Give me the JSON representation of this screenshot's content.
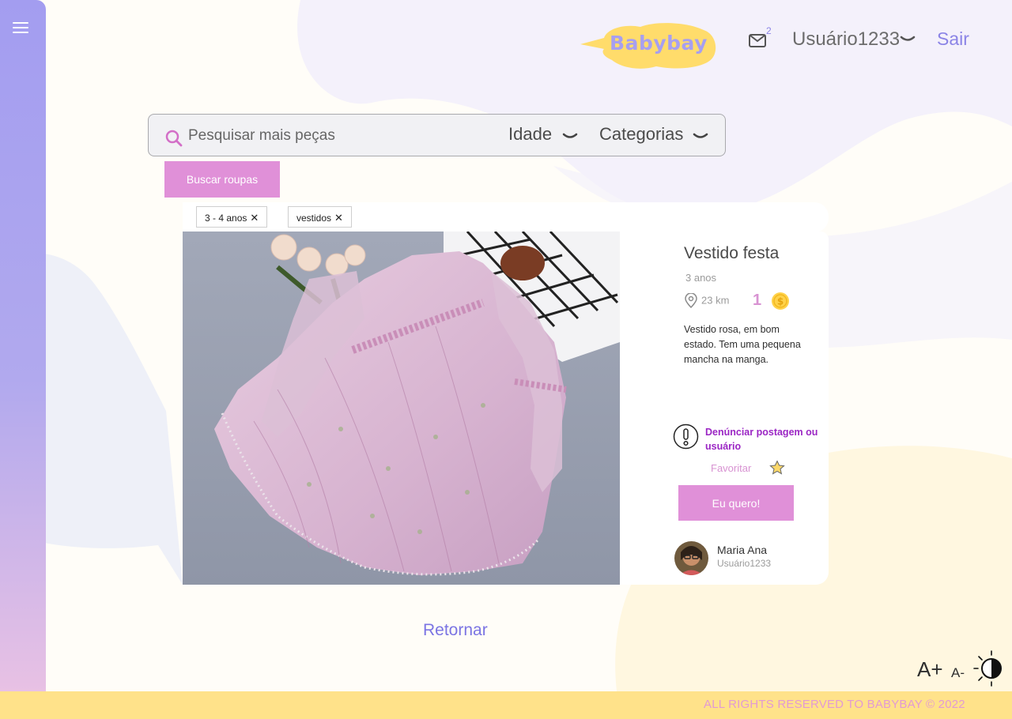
{
  "app": {
    "logo_text": "Babybay",
    "brand_colors": {
      "accent": "#8b84e6",
      "pink": "#e090d8",
      "yellow": "#ffe28a",
      "lavender": "#a39df0"
    }
  },
  "header": {
    "mail_badge_count": "2",
    "user_name": "Usuário1233",
    "logout_label": "Sair",
    "icons": [
      "menu-icon",
      "mail-icon",
      "chevron-down-icon"
    ]
  },
  "search": {
    "placeholder": "Pesquisar mais peças",
    "value": "",
    "age_filter_label": "Idade",
    "category_filter_label": "Categorias",
    "button_label": "Buscar roupas"
  },
  "tags": [
    {
      "label": "3 - 4 anos",
      "remove": "✕"
    },
    {
      "label": "vestidos",
      "remove": "✕"
    }
  ],
  "product": {
    "title": "Vestido festa",
    "age": "3 anos",
    "distance": "23 km",
    "price": "1",
    "description": "Vestido rosa, em bom estado. Tem uma pequena mancha na manga.",
    "report_label": "Denúnciar postagem ou usuário",
    "favorite_label": "Favoritar",
    "want_button_label": "Eu quero!",
    "image_alt": "pink-tulle-dress-photo"
  },
  "seller": {
    "name": "Maria Ana",
    "username": "Usuário1233"
  },
  "actions": {
    "back_label": "Retornar",
    "font_increase_label": "A+",
    "font_decrease_label": "A-"
  },
  "footer": {
    "text": "ALL RIGHTS RESERVED TO BABYBAY © 2022"
  }
}
